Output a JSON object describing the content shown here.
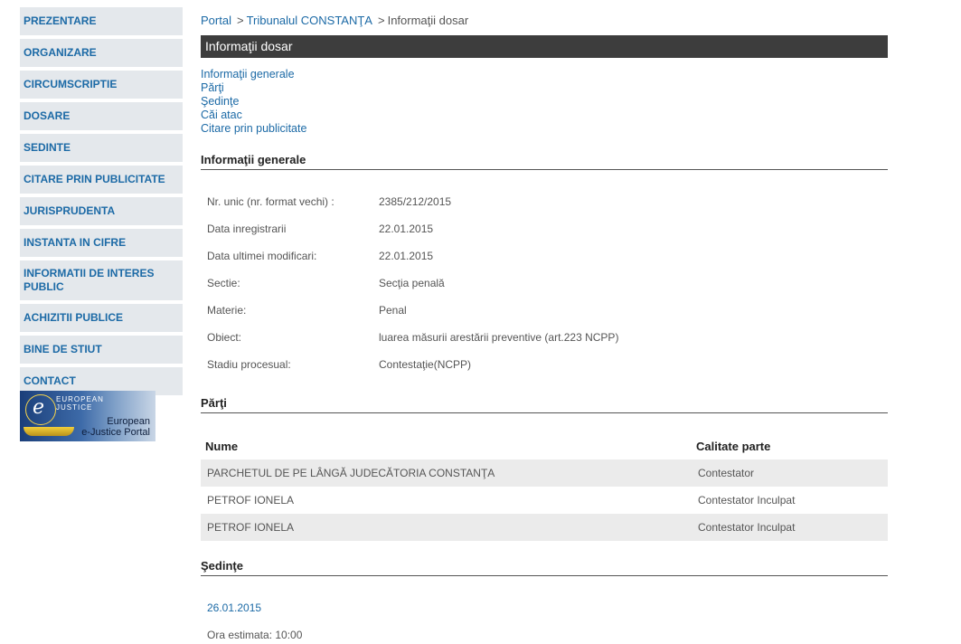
{
  "sidebar": {
    "items": [
      {
        "label": "PREZENTARE"
      },
      {
        "label": "ORGANIZARE"
      },
      {
        "label": "CIRCUMSCRIPTIE"
      },
      {
        "label": "DOSARE"
      },
      {
        "label": "SEDINTE"
      },
      {
        "label": "CITARE PRIN PUBLICITATE"
      },
      {
        "label": "JURISPRUDENTA"
      },
      {
        "label": "INSTANTA IN CIFRE"
      },
      {
        "label": "INFORMATII DE INTERES PUBLIC"
      },
      {
        "label": "ACHIZITII PUBLICE"
      },
      {
        "label": "BINE DE STIUT"
      },
      {
        "label": "CONTACT"
      }
    ],
    "banner": {
      "logo_top": "EUROPEAN",
      "logo_bottom": "JUSTICE",
      "line1": "European",
      "line2": "e-Justice Portal"
    }
  },
  "breadcrumb": {
    "portal": "Portal",
    "sep": ">",
    "court": "Tribunalul CONSTANŢA",
    "current": "Informaţii dosar"
  },
  "title": "Informaţii dosar",
  "anchors": [
    "Informaţii generale",
    "Părţi",
    "Şedinţe",
    "Căi atac",
    "Citare prin publicitate"
  ],
  "general": {
    "heading": "Informaţii generale",
    "rows": [
      {
        "label": "Nr. unic (nr. format vechi) :",
        "value": "2385/212/2015"
      },
      {
        "label": "Data inregistrarii",
        "value": "22.01.2015"
      },
      {
        "label": "Data ultimei modificari:",
        "value": "22.01.2015"
      },
      {
        "label": "Sectie:",
        "value": "Secţia penală"
      },
      {
        "label": "Materie:",
        "value": "Penal"
      },
      {
        "label": "Obiect:",
        "value": "luarea măsurii arestării preventive (art.223 NCPP)"
      },
      {
        "label": "Stadiu procesual:",
        "value": "Contestaţie(NCPP)"
      }
    ]
  },
  "parti": {
    "heading": "Părţi",
    "col_name": "Nume",
    "col_role": "Calitate parte",
    "rows": [
      {
        "name": "PARCHETUL DE PE LÂNGĂ JUDECĂTORIA CONSTANŢA",
        "role": "Contestator"
      },
      {
        "name": "PETROF IONELA",
        "role": "Contestator Inculpat"
      },
      {
        "name": "PETROF IONELA",
        "role": "Contestator Inculpat"
      }
    ]
  },
  "sedinte": {
    "heading": "Şedinţe",
    "date": "26.01.2015",
    "ora": "Ora estimata: 10:00"
  }
}
